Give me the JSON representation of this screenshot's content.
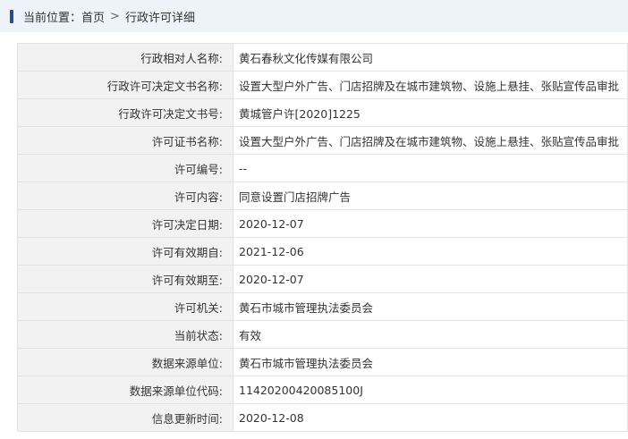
{
  "breadcrumb": {
    "prefix": "当前位置：",
    "home": "首页",
    "separator": ">",
    "current": "行政许可详细"
  },
  "details": [
    {
      "label": "行政相对人名称:",
      "value": "黄石春秋文化传媒有限公司"
    },
    {
      "label": "行政许可决定文书名称:",
      "value": "设置大型户外广告、门店招牌及在城市建筑物、设施上悬挂、张贴宣传品审批"
    },
    {
      "label": "行政许可决定文书号:",
      "value": "黄城管户许[2020]1225"
    },
    {
      "label": "许可证书名称:",
      "value": "设置大型户外广告、门店招牌及在城市建筑物、设施上悬挂、张贴宣传品审批"
    },
    {
      "label": "许可编号:",
      "value": "--"
    },
    {
      "label": "许可内容:",
      "value": "同意设置门店招牌广告"
    },
    {
      "label": "许可决定日期:",
      "value": "2020-12-07"
    },
    {
      "label": "许可有效期自:",
      "value": "2021-12-06"
    },
    {
      "label": "许可有效期至:",
      "value": "2020-12-07"
    },
    {
      "label": "许可机关:",
      "value": "黄石市城市管理执法委员会"
    },
    {
      "label": "当前状态:",
      "value": "有效"
    },
    {
      "label": "数据来源单位:",
      "value": "黄石市城市管理执法委员会"
    },
    {
      "label": "数据来源单位代码:",
      "value": "11420200420085100J"
    },
    {
      "label": "信息更新时间:",
      "value": "2020-12-08"
    }
  ],
  "colors": {
    "breadcrumb_bg": "#eef3f9",
    "marker": "#2f4a8a",
    "label_bg": "#f2f2f2",
    "border": "#e3e3e3"
  }
}
